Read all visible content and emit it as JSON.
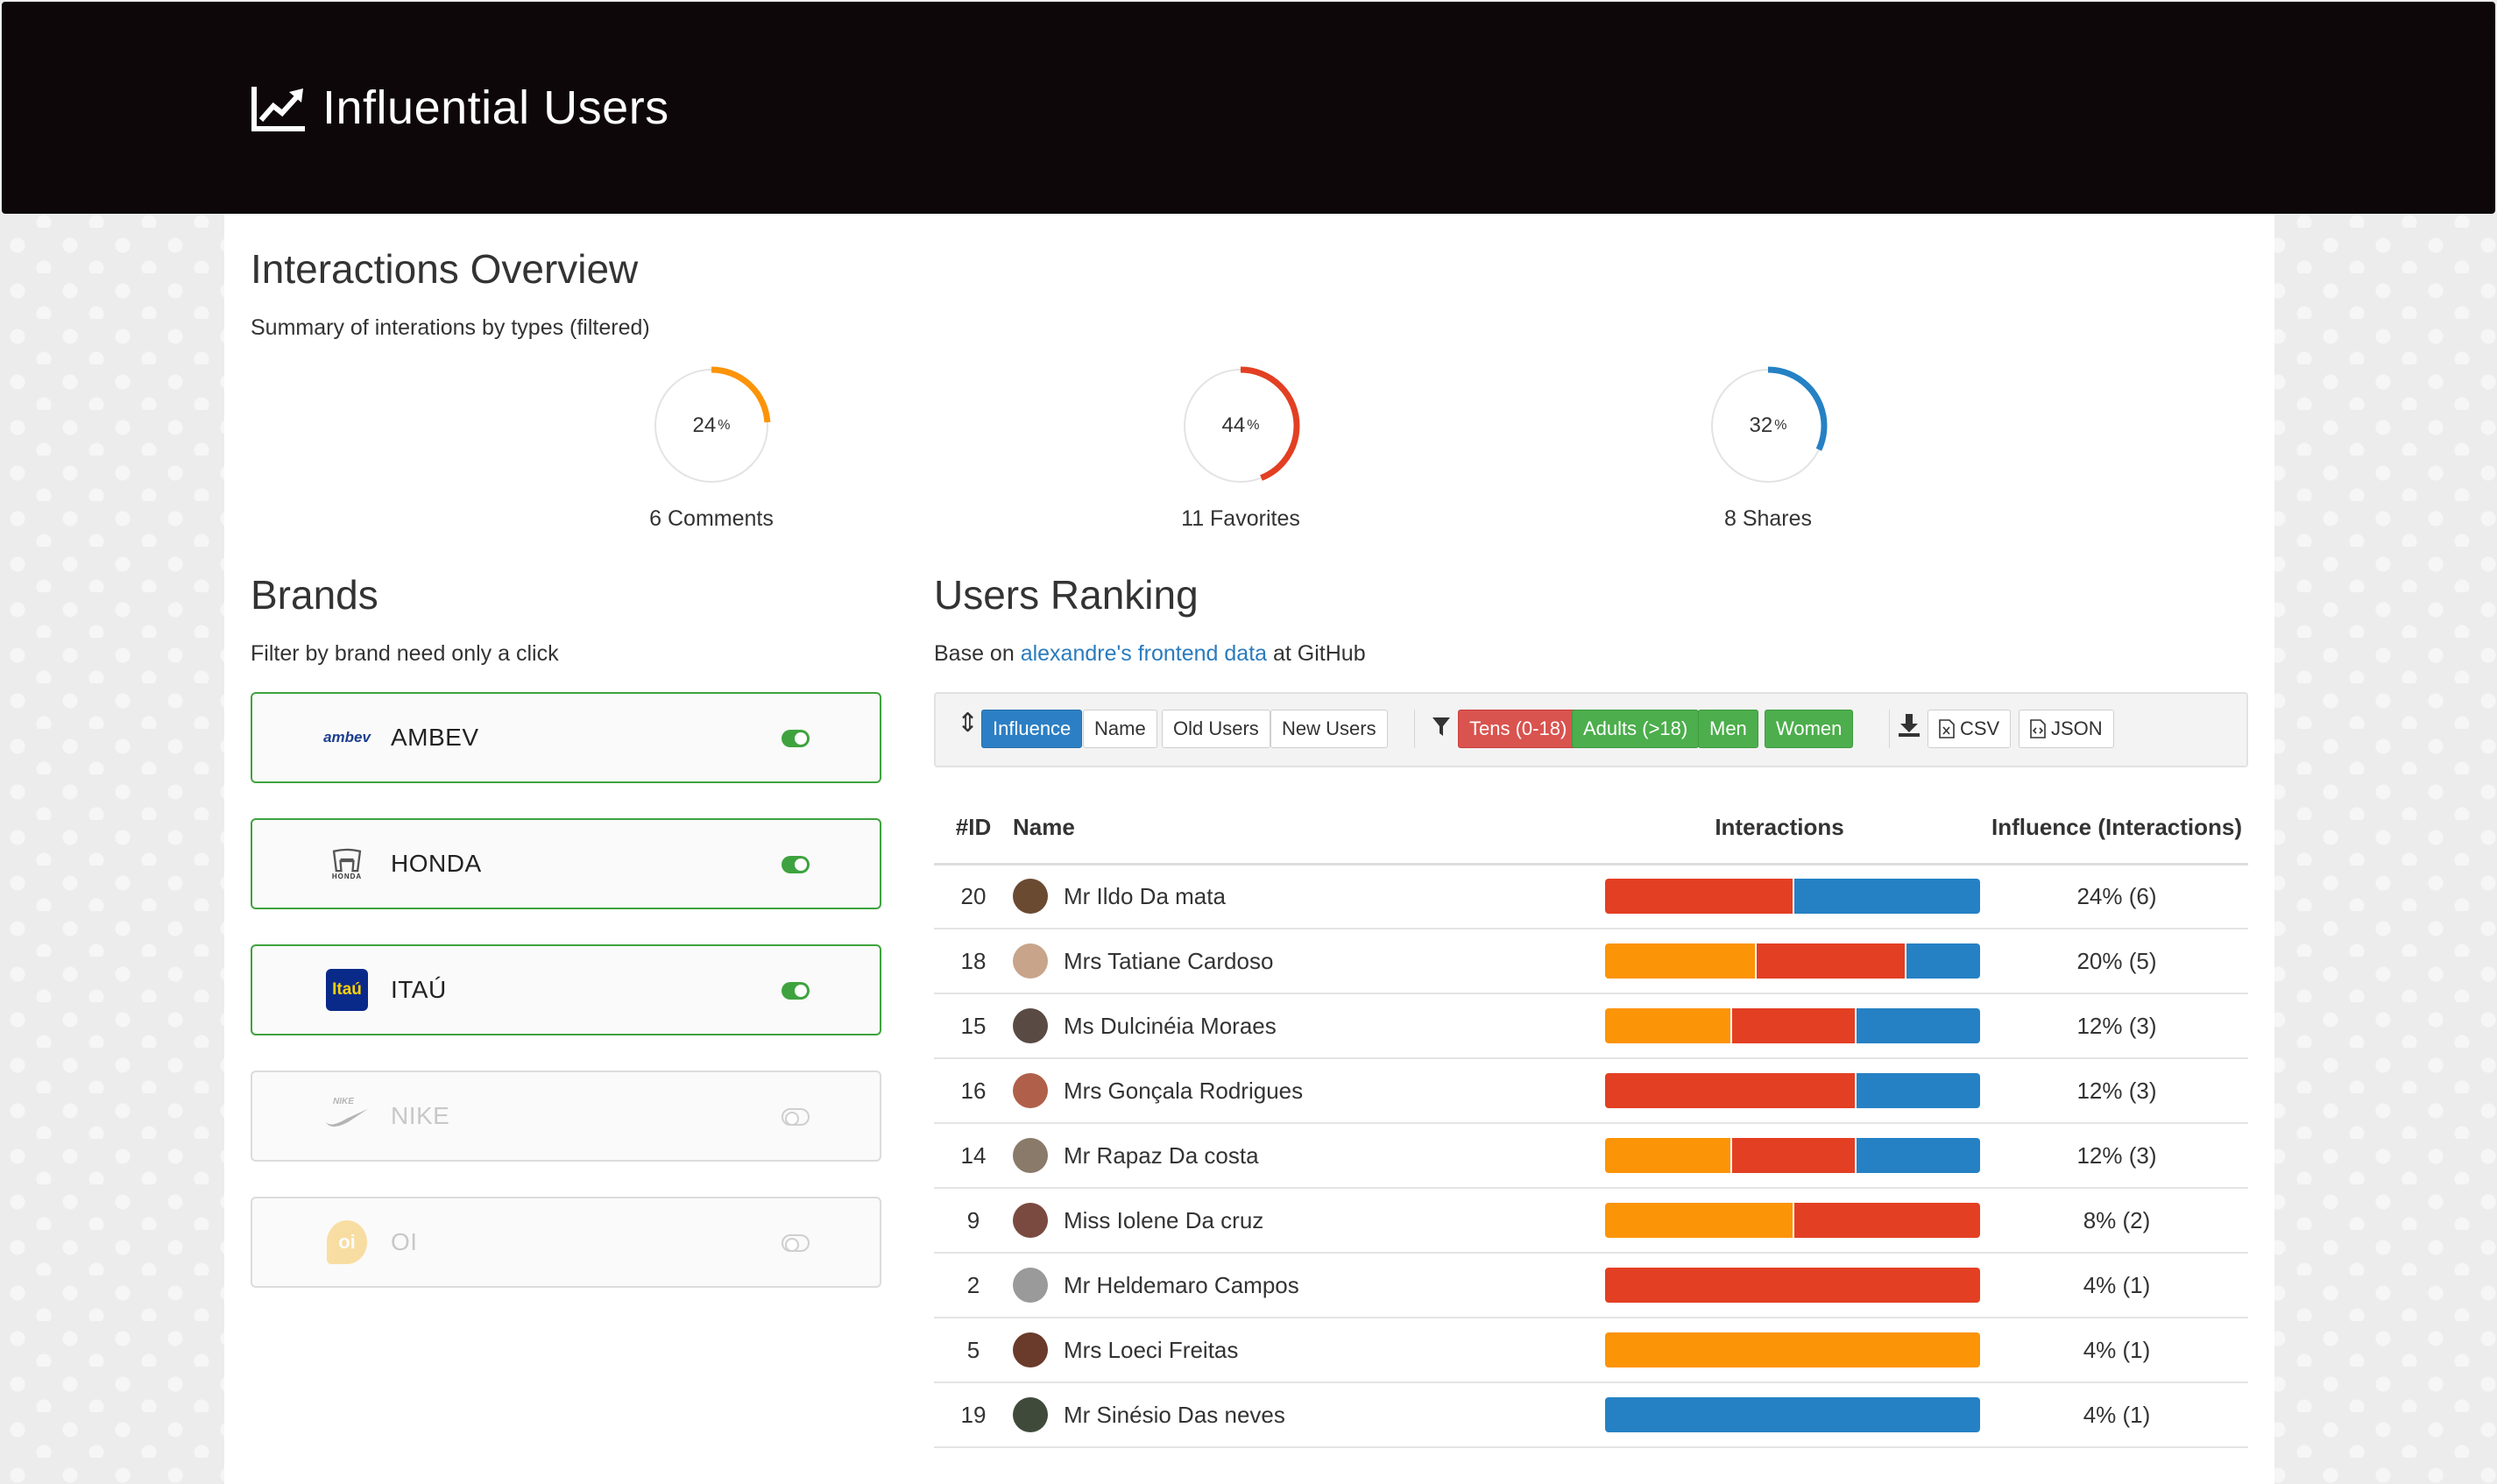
{
  "app": {
    "title": "Influential Users",
    "title_icon": "line-chart-icon"
  },
  "overview": {
    "title": "Interactions Overview",
    "subtitle": "Summary of interations by types (filtered)",
    "gauges": [
      {
        "pct": 24,
        "label": "6 Comments",
        "color": "#fc9408"
      },
      {
        "pct": 44,
        "label": "11 Favorites",
        "color": "#e33f23"
      },
      {
        "pct": 32,
        "label": "8 Shares",
        "color": "#2581c4"
      }
    ],
    "pct_suffix": "%"
  },
  "brands": {
    "title": "Brands",
    "subtitle": "Filter by brand need only a click",
    "items": [
      {
        "name": "AMBEV",
        "logo": "ambev",
        "on": true
      },
      {
        "name": "HONDA",
        "logo": "HONDA",
        "on": true
      },
      {
        "name": "ITAÚ",
        "logo": "Itaú",
        "on": true
      },
      {
        "name": "NIKE",
        "logo": "NIKE",
        "on": false
      },
      {
        "name": "OI",
        "logo": "oi",
        "on": false
      }
    ]
  },
  "ranking": {
    "title": "Users Ranking",
    "subtitle_pre": "Base on ",
    "subtitle_link": "alexandre's frontend data",
    "subtitle_post": " at GitHub",
    "sort_buttons": [
      "Influence",
      "Name",
      "Old Users",
      "New Users"
    ],
    "filter_buttons": [
      "Tens (0-18)",
      "Adults (>18)",
      "Men",
      "Women"
    ],
    "export_buttons": [
      "CSV",
      "JSON"
    ],
    "columns": [
      "#ID",
      "Name",
      "Interactions",
      "Influence (Interactions)"
    ],
    "rows": [
      {
        "id": "20",
        "name": "Mr Ildo Da mata",
        "influence": "24% (6)",
        "comments": 0,
        "favorites": 3,
        "shares": 3,
        "avatar": "#6b4a32"
      },
      {
        "id": "18",
        "name": "Mrs Tatiane Cardoso",
        "influence": "20% (5)",
        "comments": 2,
        "favorites": 2,
        "shares": 1,
        "avatar": "#c8a48a"
      },
      {
        "id": "15",
        "name": "Ms Dulcinéia Moraes",
        "influence": "12% (3)",
        "comments": 1,
        "favorites": 1,
        "shares": 1,
        "avatar": "#5a4a44"
      },
      {
        "id": "16",
        "name": "Mrs Gonçala Rodrigues",
        "influence": "12% (3)",
        "comments": 0,
        "favorites": 2,
        "shares": 1,
        "avatar": "#b0604a"
      },
      {
        "id": "14",
        "name": "Mr Rapaz Da costa",
        "influence": "12% (3)",
        "comments": 1,
        "favorites": 1,
        "shares": 1,
        "avatar": "#8a7a6a"
      },
      {
        "id": "9",
        "name": "Miss Iolene Da cruz",
        "influence": "8% (2)",
        "comments": 1,
        "favorites": 1,
        "shares": 0,
        "avatar": "#7a4a40"
      },
      {
        "id": "2",
        "name": "Mr Heldemaro Campos",
        "influence": "4% (1)",
        "comments": 0,
        "favorites": 1,
        "shares": 0,
        "avatar": "#9a9a9a"
      },
      {
        "id": "5",
        "name": "Mrs Loeci Freitas",
        "influence": "4% (1)",
        "comments": 1,
        "favorites": 0,
        "shares": 0,
        "avatar": "#6a3a2a"
      },
      {
        "id": "19",
        "name": "Mr Sinésio Das neves",
        "influence": "4% (1)",
        "comments": 0,
        "favorites": 0,
        "shares": 1,
        "avatar": "#3f4a3a"
      }
    ]
  }
}
